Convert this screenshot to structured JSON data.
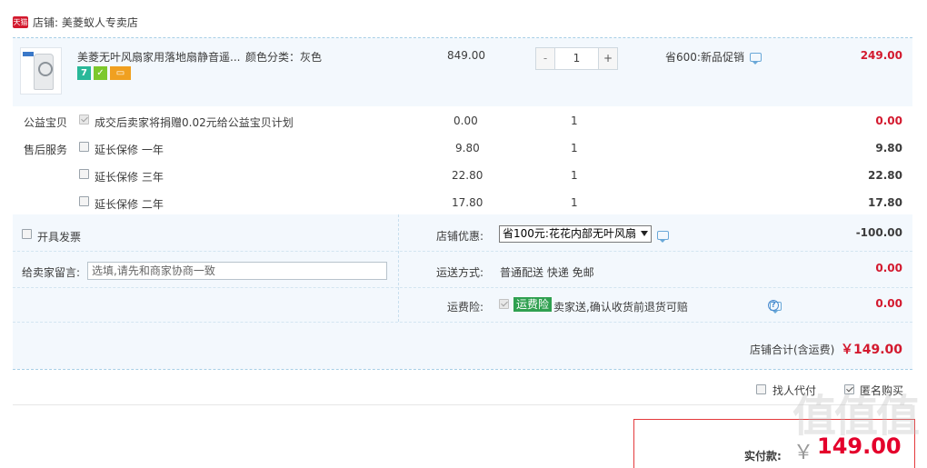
{
  "shop": {
    "badge": "天猫",
    "label": "店铺: 美菱蚁人专卖店"
  },
  "item": {
    "title": "美菱无叶风扇家用落地扇静音遥...",
    "sku": "颜色分类：灰色",
    "badges": [
      "7",
      "",
      ""
    ],
    "unit_price": "849.00",
    "qty": "1",
    "minus": "-",
    "plus": "+",
    "promo": "省600:新品促销",
    "subtotal": "249.00"
  },
  "services": {
    "charity_label": "公益宝贝",
    "charity_text": "成交后卖家将捐赠0.02元给公益宝贝计划",
    "charity_price": "0.00",
    "charity_qty": "1",
    "charity_total": "0.00",
    "aftersale_label": "售后服务",
    "warranties": [
      {
        "name": "延长保修 一年",
        "price": "9.80",
        "qty": "1",
        "total": "9.80"
      },
      {
        "name": "延长保修 三年",
        "price": "22.80",
        "qty": "1",
        "total": "22.80"
      },
      {
        "name": "延长保修 二年",
        "price": "17.80",
        "qty": "1",
        "total": "17.80"
      }
    ]
  },
  "options": {
    "invoice_label": "开具发票",
    "shop_discount_label": "店铺优惠:",
    "shop_discount_value": "省100元:花花内部无叶风扇",
    "shop_discount_amount": "-100.00",
    "message_label": "给卖家留言:",
    "message_placeholder": "选填,请先和商家协商一致",
    "shipping_label": "运送方式:",
    "shipping_value": "普通配送 快递 免邮",
    "shipping_amount": "0.00",
    "insurance_label": "运费险:",
    "insurance_tag": "运费险",
    "insurance_text": "卖家送,确认收货前退货可赔",
    "insurance_amount": "0.00",
    "help": "?"
  },
  "summary": {
    "label": "店铺合计(含运费)",
    "amount": "￥149.00"
  },
  "checkout": {
    "pay_for_me": "找人代付",
    "anonymous": "匿名购买",
    "pay_label": "实付款:",
    "yen": "￥",
    "pay_amount": "149.00"
  },
  "watermark": "值值值"
}
